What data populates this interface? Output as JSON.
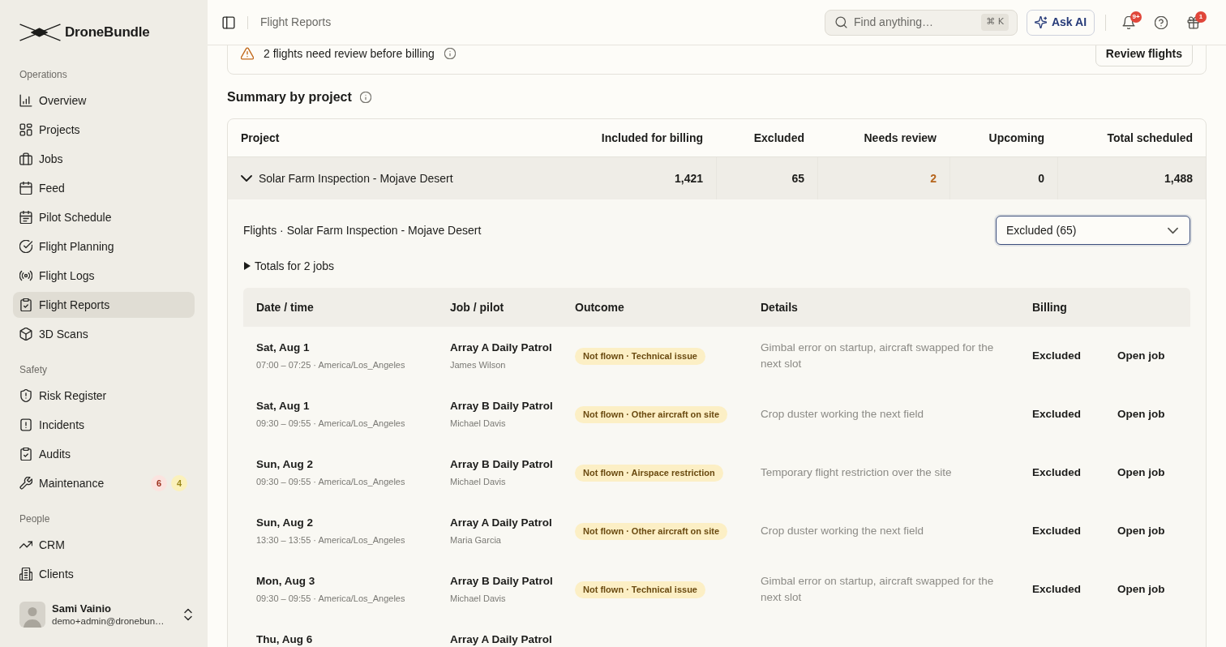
{
  "sidebar": {
    "brand": "DroneBundle",
    "sections": [
      {
        "label": "Operations",
        "items": [
          {
            "label": "Overview",
            "selected": false
          },
          {
            "label": "Projects",
            "selected": false
          },
          {
            "label": "Jobs",
            "selected": false
          },
          {
            "label": "Feed",
            "selected": false
          },
          {
            "label": "Pilot Schedule",
            "selected": false
          },
          {
            "label": "Flight Planning",
            "selected": false
          },
          {
            "label": "Flight Logs",
            "selected": false
          },
          {
            "label": "Flight Reports",
            "selected": true
          },
          {
            "label": "3D Scans",
            "selected": false
          }
        ]
      },
      {
        "label": "Safety",
        "items": [
          {
            "label": "Risk Register",
            "selected": false
          },
          {
            "label": "Incidents",
            "selected": false
          },
          {
            "label": "Audits",
            "selected": false
          },
          {
            "label": "Maintenance",
            "selected": false,
            "badges": [
              {
                "text": "6",
                "color": "#fbe3df"
              },
              {
                "text": "4",
                "color": "#fbf1bb"
              }
            ]
          }
        ]
      },
      {
        "label": "People",
        "items": [
          {
            "label": "CRM",
            "selected": false
          },
          {
            "label": "Clients",
            "selected": false
          }
        ]
      }
    ],
    "user": {
      "name": "Sami Vainio",
      "email": "demo+admin@dronebun…"
    }
  },
  "topbar": {
    "breadcrumb": "Flight Reports",
    "search": {
      "placeholder": "Find anything…",
      "shortcut": "⌘ K"
    },
    "ask_ai": "Ask AI",
    "notifications_badge": "9+",
    "gifts_badge": "1"
  },
  "alert": {
    "message": "2 flights need review before billing",
    "action": "Review flights"
  },
  "summary": {
    "title": "Summary by project",
    "columns": [
      "Project",
      "Included for billing",
      "Excluded",
      "Needs review",
      "Upcoming",
      "Total scheduled"
    ],
    "rows": [
      {
        "project": "Solar Farm Inspection - Mojave Desert",
        "expanded": true,
        "included": "1,421",
        "excluded": "65",
        "needs_review": "2",
        "needs_review_flagged": true,
        "upcoming": "0",
        "total": "1,488",
        "flights": {
          "title": "Flights · Solar Farm Inspection - Mojave Desert",
          "filter": "Excluded (65)",
          "totals": "Totals for 2 jobs",
          "totals_expanded": false,
          "columns": [
            "Date / time",
            "Job / pilot",
            "Outcome",
            "Details",
            "Billing"
          ],
          "rows": [
            {
              "date": "Sat, Aug 1",
              "time": "07:00 – 07:25 · America/Los_Angeles",
              "job": "Array A Daily Patrol",
              "pilot": "James Wilson",
              "outcome": "Not flown · Technical issue",
              "details": "Gimbal error on startup, aircraft swapped for the next slot",
              "billing": "Excluded",
              "action": "Open job"
            },
            {
              "date": "Sat, Aug 1",
              "time": "09:30 – 09:55 · America/Los_Angeles",
              "job": "Array B Daily Patrol",
              "pilot": "Michael Davis",
              "outcome": "Not flown · Other aircraft on site",
              "details": "Crop duster working the next field",
              "billing": "Excluded",
              "action": "Open job"
            },
            {
              "date": "Sun, Aug 2",
              "time": "09:30 – 09:55 · America/Los_Angeles",
              "job": "Array B Daily Patrol",
              "pilot": "Michael Davis",
              "outcome": "Not flown · Airspace restriction",
              "details": "Temporary flight restriction over the site",
              "billing": "Excluded",
              "action": "Open job"
            },
            {
              "date": "Sun, Aug 2",
              "time": "13:30 – 13:55 · America/Los_Angeles",
              "job": "Array A Daily Patrol",
              "pilot": "Maria Garcia",
              "outcome": "Not flown · Other aircraft on site",
              "details": "Crop duster working the next field",
              "billing": "Excluded",
              "action": "Open job"
            },
            {
              "date": "Mon, Aug 3",
              "time": "09:30 – 09:55 · America/Los_Angeles",
              "job": "Array B Daily Patrol",
              "pilot": "Michael Davis",
              "outcome": "Not flown · Technical issue",
              "details": "Gimbal error on startup, aircraft swapped for the next slot",
              "billing": "Excluded",
              "action": "Open job"
            },
            {
              "date": "Thu, Aug 6",
              "job": "Array A Daily Patrol"
            }
          ]
        }
      }
    ]
  }
}
